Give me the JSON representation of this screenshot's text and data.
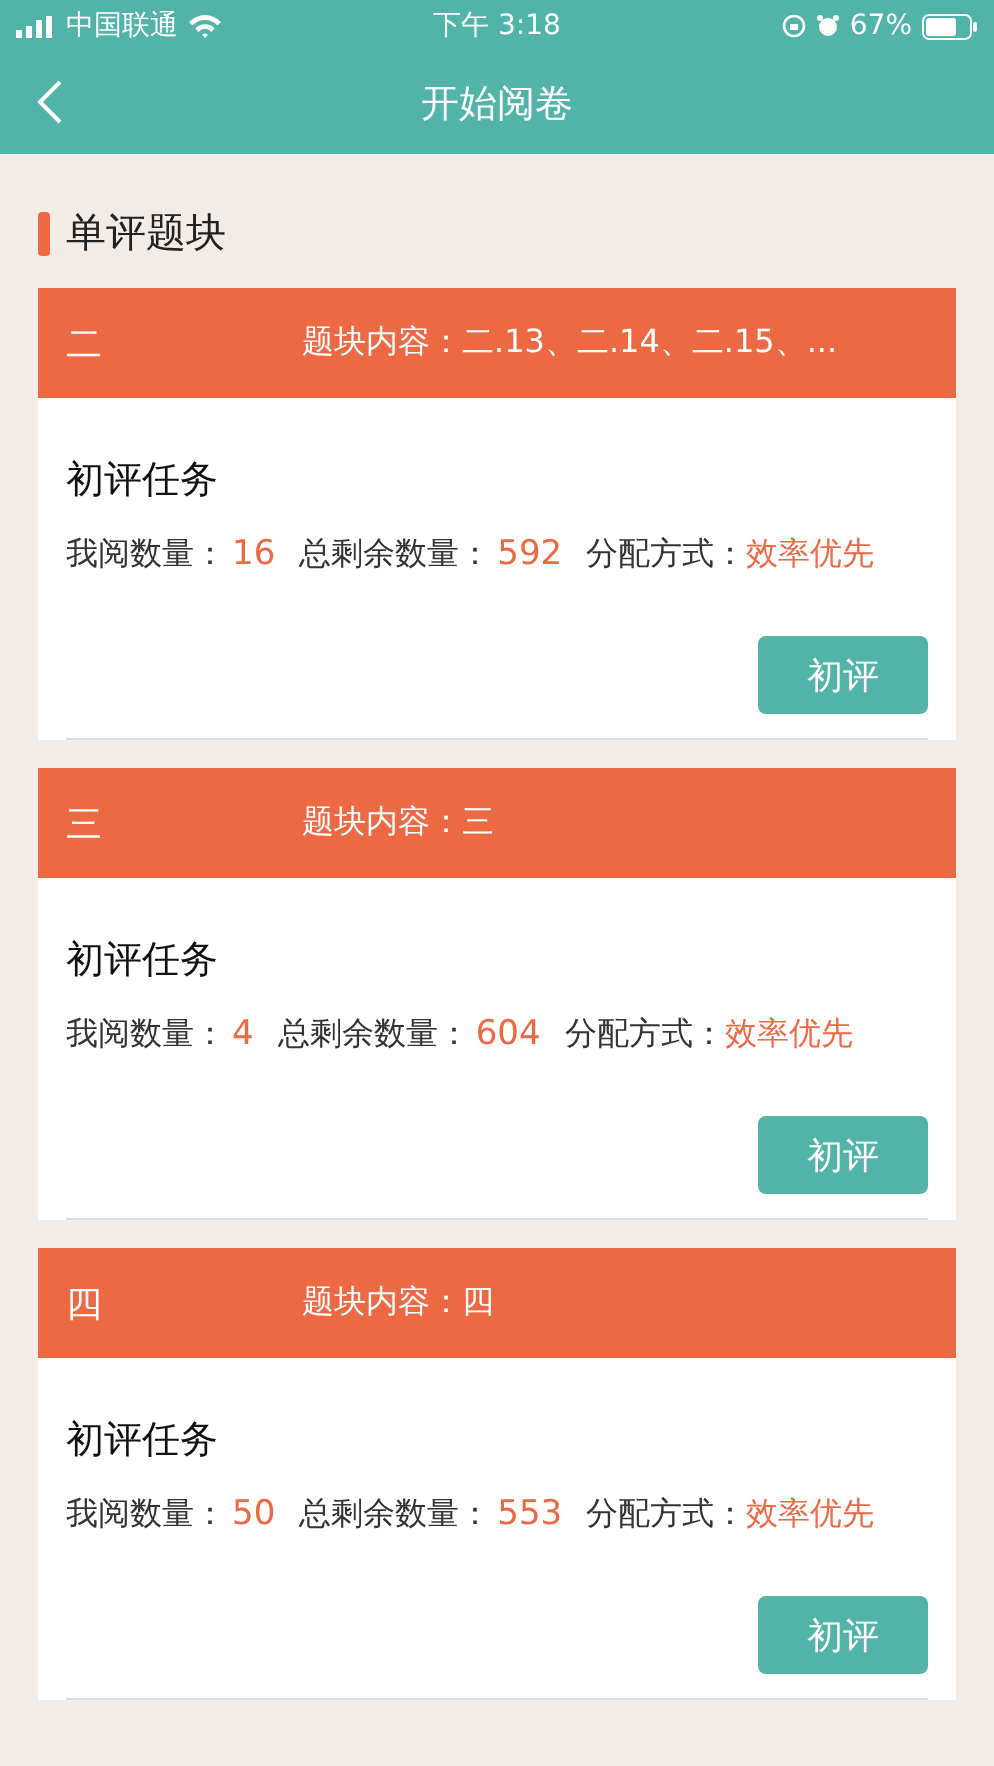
{
  "status_bar": {
    "carrier": "中国联通",
    "time": "下午 3:18",
    "battery": "67%"
  },
  "nav": {
    "title": "开始阅卷"
  },
  "section": {
    "title": "单评题块"
  },
  "blocks": [
    {
      "name": "二",
      "content_label": "题块内容：",
      "content": "二.13、二.14、二.15、...",
      "task": "初评任务",
      "read_label": "我阅数量：",
      "read": "16",
      "remain_label": "总剩余数量：",
      "remain": "592",
      "mode_label": "分配方式：",
      "mode": "效率优先",
      "button": "初评"
    },
    {
      "name": "三",
      "content_label": "题块内容：",
      "content": "三",
      "task": "初评任务",
      "read_label": "我阅数量：",
      "read": "4",
      "remain_label": "总剩余数量：",
      "remain": "604",
      "mode_label": "分配方式：",
      "mode": "效率优先",
      "button": "初评"
    },
    {
      "name": "四",
      "content_label": "题块内容：",
      "content": "四",
      "task": "初评任务",
      "read_label": "我阅数量：",
      "read": "50",
      "remain_label": "总剩余数量：",
      "remain": "553",
      "mode_label": "分配方式：",
      "mode": "效率优先",
      "button": "初评"
    }
  ]
}
